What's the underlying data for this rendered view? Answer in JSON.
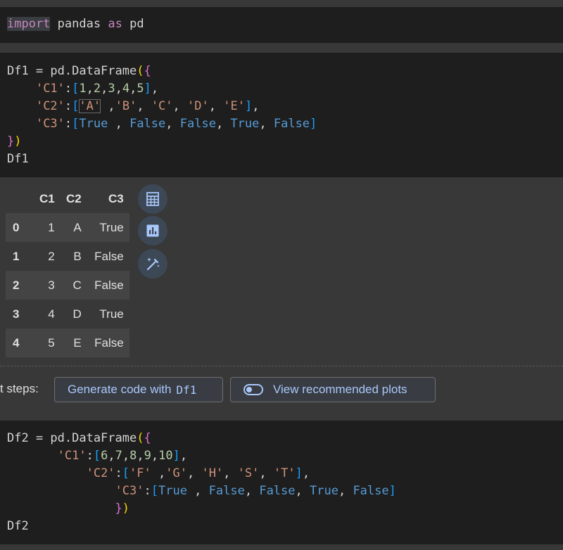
{
  "cell1": {
    "keyword_import": "import",
    "module": "pandas",
    "keyword_as": "as",
    "alias": "pd"
  },
  "cell2": {
    "lines": {
      "l1_name": "Df1 = pd.DataFrame",
      "l2_key": "'C1'",
      "l2_vals": [
        "1",
        "2",
        "3",
        "4",
        "5"
      ],
      "l3_key": "'C2'",
      "l3_vals": [
        "'A'",
        "'B'",
        "'C'",
        "'D'",
        "'E'"
      ],
      "l4_key": "'C3'",
      "l4_vals": [
        "True",
        "False",
        "False",
        "True",
        "False"
      ],
      "l6": "Df1"
    }
  },
  "output": {
    "columns": [
      "C1",
      "C2",
      "C3"
    ],
    "rows": [
      {
        "idx": "0",
        "c1": "1",
        "c2": "A",
        "c3": "True"
      },
      {
        "idx": "1",
        "c1": "2",
        "c2": "B",
        "c3": "False"
      },
      {
        "idx": "2",
        "c1": "3",
        "c2": "C",
        "c3": "False"
      },
      {
        "idx": "3",
        "c1": "4",
        "c2": "D",
        "c3": "True"
      },
      {
        "idx": "4",
        "c1": "5",
        "c2": "E",
        "c3": "False"
      }
    ],
    "icons": [
      "table-icon",
      "bar-chart-icon",
      "magic-wand-icon"
    ]
  },
  "next_steps": {
    "label": "t steps:",
    "generate_label": "Generate code with",
    "generate_var": "Df1",
    "plots_label": "View recommended plots"
  },
  "cell3": {
    "lines": {
      "l1_name": "Df2 = pd.DataFrame",
      "l2_key": "'C1'",
      "l2_vals": [
        "6",
        "7",
        "8",
        "9",
        "10"
      ],
      "l3_key": "'C2'",
      "l3_vals": [
        "'F'",
        "'G'",
        "'H'",
        "'S'",
        "'T'"
      ],
      "l4_key": "'C3'",
      "l4_vals": [
        "True",
        "False",
        "False",
        "True",
        "False"
      ],
      "l6": "Df2"
    }
  },
  "colors": {
    "cell_bg": "#1e1e1e",
    "page_bg": "#383838",
    "keyword": "#c586c0",
    "string": "#ce9178",
    "number": "#b5cea8",
    "boolean": "#569cd6",
    "chip_text": "#a8c7fa"
  }
}
